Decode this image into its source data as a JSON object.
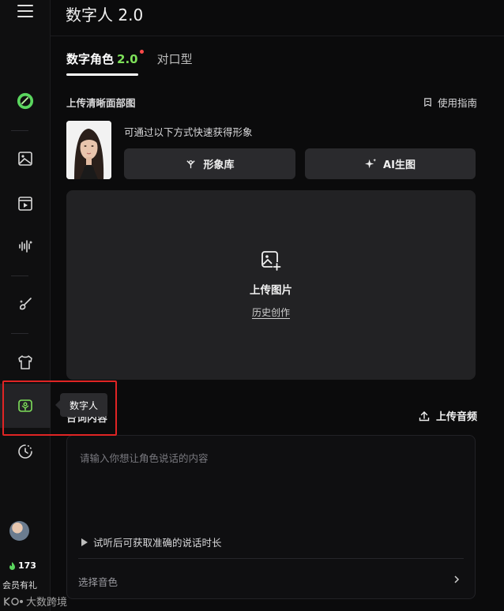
{
  "header": {
    "title": "数字人 2.0"
  },
  "tabs": [
    {
      "label": "数字角色",
      "version": "2.0"
    },
    {
      "label": "对口型"
    }
  ],
  "upload_section": {
    "label": "上传清晰面部图",
    "guide": "使用指南",
    "hint": "可通过以下方式快速获得形象",
    "btn_library": "形象库",
    "btn_ai": "AI生图",
    "upload_title": "上传图片",
    "history": "历史创作"
  },
  "script_section": {
    "label": "台词内容",
    "upload_audio": "上传音频",
    "placeholder": "请输入你想让角色说话的内容",
    "listen_hint": "试听后可获取准确的说话时长",
    "voice_select": "选择音色"
  },
  "sidebar": {
    "tooltip": "数字人",
    "points": "173",
    "member": "会员有礼",
    "watermark": "大数跨境"
  },
  "colors": {
    "accent_green": "#7ee05a",
    "highlight_red": "#e02424",
    "dot_red": "#ff4a4a"
  },
  "icons": [
    "menu-icon",
    "logo-icon",
    "image-icon",
    "video-icon",
    "audio-wave-icon",
    "brush-icon",
    "shirt-icon",
    "digital-human-icon",
    "history-icon"
  ]
}
